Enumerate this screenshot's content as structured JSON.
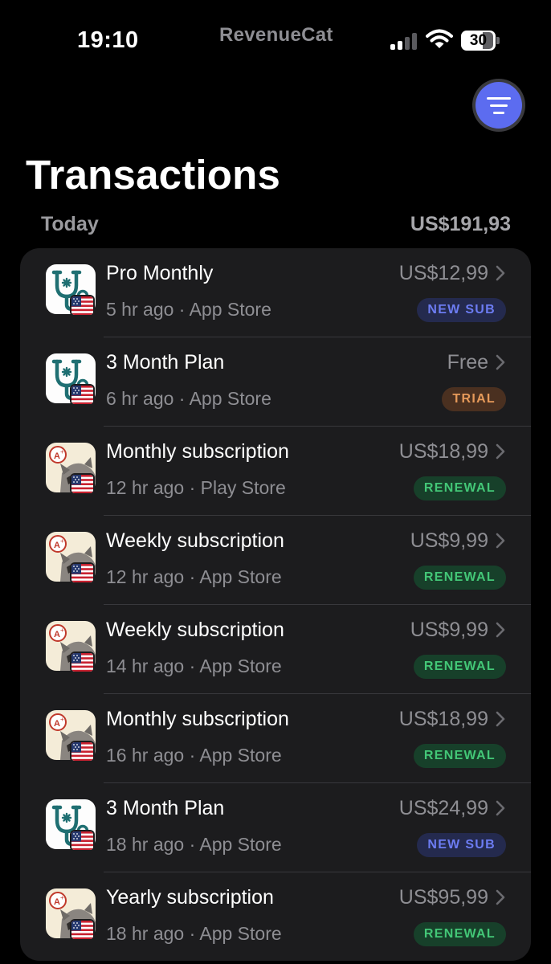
{
  "status_bar": {
    "time": "19:10",
    "brand": "RevenueCat",
    "battery": "30",
    "icons": [
      "signal-icon",
      "wifi-icon",
      "battery-icon"
    ]
  },
  "filter_button": {
    "icon": "filter-icon",
    "color": "#5c6cf0"
  },
  "title": "Transactions",
  "section": {
    "label": "Today",
    "total": "US$191,93"
  },
  "colors": {
    "new_sub": "#6c7cf2",
    "trial": "#e69a5a",
    "renewal": "#43c777",
    "card": "#1c1c1e"
  },
  "transactions": [
    {
      "app_icon": "stethoscope-app-icon",
      "flag": "us-flag-icon",
      "product": "Pro Monthly",
      "meta": "5 hr ago · App Store",
      "price": "US$12,99",
      "badge": "NEW SUB",
      "badge_type": "new"
    },
    {
      "app_icon": "stethoscope-app-icon",
      "flag": "us-flag-icon",
      "product": "3 Month Plan",
      "meta": "6 hr ago · App Store",
      "price": "Free",
      "badge": "TRIAL",
      "badge_type": "trial"
    },
    {
      "app_icon": "raccoon-app-icon",
      "flag": "us-flag-icon",
      "product": "Monthly subscription",
      "meta": "12 hr ago · Play Store",
      "price": "US$18,99",
      "badge": "RENEWAL",
      "badge_type": "renewal"
    },
    {
      "app_icon": "raccoon-app-icon",
      "flag": "us-flag-icon",
      "product": "Weekly subscription",
      "meta": "12 hr ago · App Store",
      "price": "US$9,99",
      "badge": "RENEWAL",
      "badge_type": "renewal"
    },
    {
      "app_icon": "raccoon-app-icon",
      "flag": "us-flag-icon",
      "product": "Weekly subscription",
      "meta": "14 hr ago · App Store",
      "price": "US$9,99",
      "badge": "RENEWAL",
      "badge_type": "renewal"
    },
    {
      "app_icon": "raccoon-app-icon",
      "flag": "us-flag-icon",
      "product": "Monthly subscription",
      "meta": "16 hr ago · App Store",
      "price": "US$18,99",
      "badge": "RENEWAL",
      "badge_type": "renewal"
    },
    {
      "app_icon": "stethoscope-app-icon",
      "flag": "us-flag-icon",
      "product": "3 Month Plan",
      "meta": "18 hr ago · App Store",
      "price": "US$24,99",
      "badge": "NEW SUB",
      "badge_type": "new"
    },
    {
      "app_icon": "raccoon-app-icon",
      "flag": "us-flag-icon",
      "product": "Yearly subscription",
      "meta": "18 hr ago · App Store",
      "price": "US$95,99",
      "badge": "RENEWAL",
      "badge_type": "renewal"
    }
  ]
}
